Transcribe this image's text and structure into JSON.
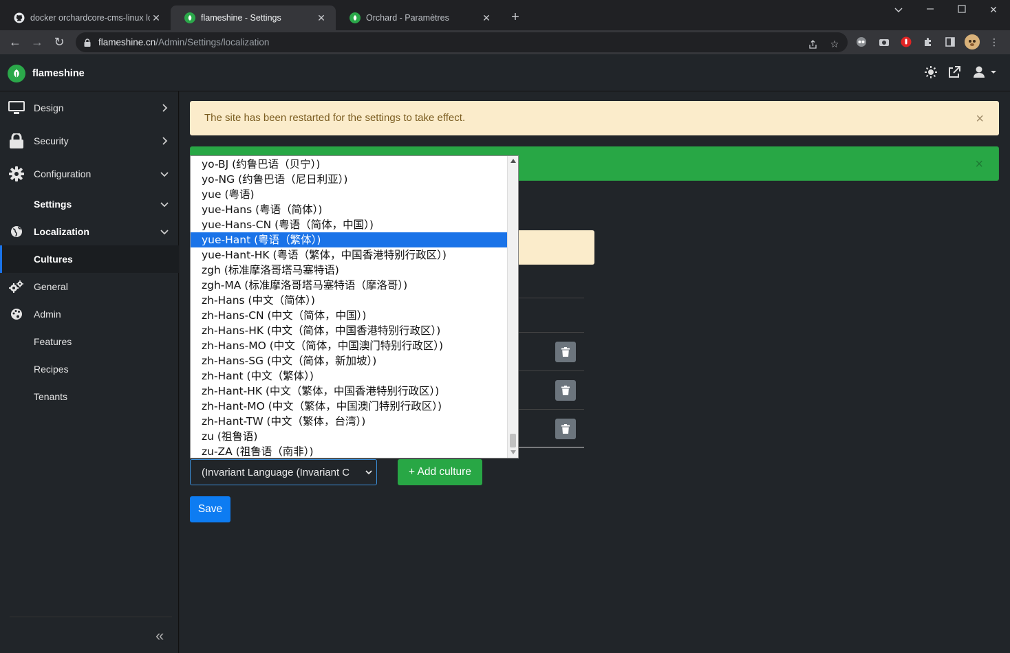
{
  "browser": {
    "tabs": [
      {
        "title": "docker orchardcore-cms-linux lo",
        "active": false
      },
      {
        "title": "flameshine - Settings",
        "active": true
      },
      {
        "title": "Orchard - Paramètres",
        "active": false
      }
    ],
    "url_host": "flameshine.cn",
    "url_path": "/Admin/Settings/localization"
  },
  "app": {
    "brand": "flameshine"
  },
  "sidebar": {
    "items": [
      {
        "label": "Design"
      },
      {
        "label": "Security"
      },
      {
        "label": "Configuration"
      },
      {
        "label": "Settings"
      },
      {
        "label": "Localization"
      },
      {
        "label": "Cultures"
      },
      {
        "label": "General"
      },
      {
        "label": "Admin"
      },
      {
        "label": "Features"
      },
      {
        "label": "Recipes"
      },
      {
        "label": "Tenants"
      }
    ]
  },
  "alerts": {
    "warning": "The site has been restarted for the settings to take effect.",
    "close": "×"
  },
  "form": {
    "culture_select_value": "(Invariant Language (Invariant C",
    "add_culture_label": "+ Add culture",
    "save_label": "Save"
  },
  "dropdown": {
    "selected_index": 5,
    "options": [
      "yo-BJ (约鲁巴语（贝宁）)",
      "yo-NG (约鲁巴语（尼日利亚）)",
      "yue (粤语)",
      "yue-Hans (粤语（简体）)",
      "yue-Hans-CN (粤语（简体，中国）)",
      "yue-Hant (粤语（繁体）)",
      "yue-Hant-HK (粤语（繁体，中国香港特别行政区）)",
      "zgh (标准摩洛哥塔马塞特语)",
      "zgh-MA (标准摩洛哥塔马塞特语（摩洛哥）)",
      "zh-Hans (中文（简体）)",
      "zh-Hans-CN (中文（简体，中国）)",
      "zh-Hans-HK (中文（简体，中国香港特别行政区）)",
      "zh-Hans-MO (中文（简体，中国澳门特别行政区）)",
      "zh-Hans-SG (中文（简体，新加坡）)",
      "zh-Hant (中文（繁体）)",
      "zh-Hant-HK (中文（繁体，中国香港特别行政区）)",
      "zh-Hant-MO (中文（繁体，中国澳门特别行政区）)",
      "zh-Hant-TW (中文（繁体，台湾）)",
      "zu (祖鲁语)",
      "zu-ZA (祖鲁语（南非）)"
    ]
  },
  "colors": {
    "accent": "#1a73e8",
    "success": "#28a745",
    "warning_bg": "#fbeccb",
    "primary": "#0d7cf2"
  }
}
